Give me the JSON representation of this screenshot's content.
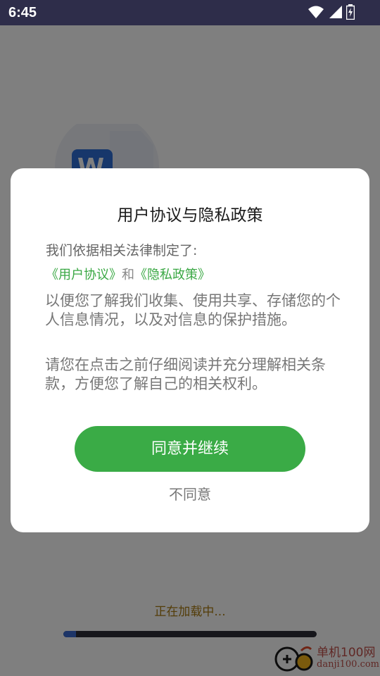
{
  "status_bar": {
    "time": "6:45"
  },
  "dialog": {
    "title": "用户协议与隐私政策",
    "intro": "我们依据相关法律制定了:",
    "link_user_agreement": "《用户协议》",
    "link_joiner": "和",
    "link_privacy_policy": "《隐私政策》",
    "paragraph1": "以便您了解我们收集、使用共享、存储您的个人信息情况，以及对信息的保护措施。",
    "paragraph2": "请您在点击之前仔细阅读并充分理解相关条款，方便您了解自己的相关权利。",
    "agree_button": "同意并继续",
    "decline_button": "不同意"
  },
  "splash": {
    "loading_text": "正在加载中...",
    "progress": 0.05
  },
  "watermark": {
    "line1": "单机100网",
    "line2": "danji100.com"
  },
  "colors": {
    "accent_green": "#3aab46",
    "link_green": "#3aa844",
    "status_bar_bg": "#2e2d4a"
  }
}
